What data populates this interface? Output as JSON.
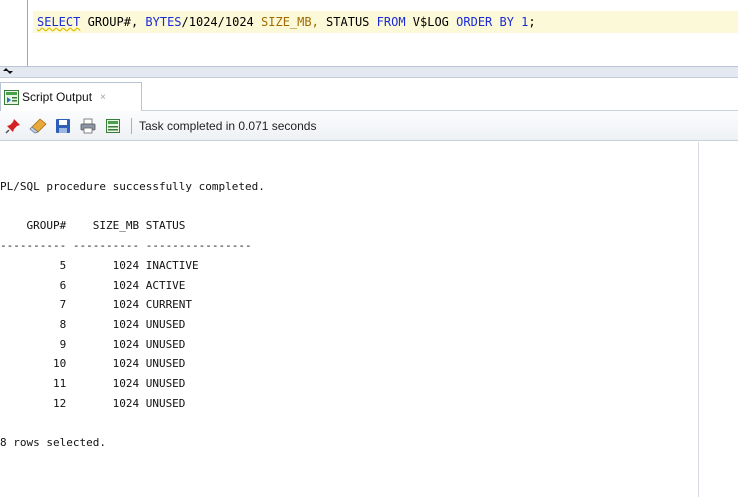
{
  "editor": {
    "query": {
      "select": "SELECT",
      "group_col": "GROUP#,",
      "bytes_kw": "BYTES",
      "expr": "/1024/1024",
      "alias": "SIZE_MB,",
      "status_col": "STATUS",
      "from": "FROM",
      "table": "V$LOG",
      "order_by": "ORDER BY",
      "order_num": "1",
      "terminator": ";"
    }
  },
  "tab": {
    "label": "Script Output",
    "close": "×"
  },
  "toolbar": {
    "status": "Task completed in 0.071 seconds",
    "icons": [
      "pin-icon",
      "eraser-icon",
      "save-icon",
      "print-icon",
      "open-file-icon"
    ]
  },
  "output": {
    "message": "PL/SQL procedure successfully completed.",
    "headers": [
      "GROUP#",
      "SIZE_MB",
      "STATUS"
    ],
    "rows": [
      {
        "group": "5",
        "size_mb": "1024",
        "status": "INACTIVE"
      },
      {
        "group": "6",
        "size_mb": "1024",
        "status": "ACTIVE"
      },
      {
        "group": "7",
        "size_mb": "1024",
        "status": "CURRENT"
      },
      {
        "group": "8",
        "size_mb": "1024",
        "status": "UNUSED"
      },
      {
        "group": "9",
        "size_mb": "1024",
        "status": "UNUSED"
      },
      {
        "group": "10",
        "size_mb": "1024",
        "status": "UNUSED"
      },
      {
        "group": "11",
        "size_mb": "1024",
        "status": "UNUSED"
      },
      {
        "group": "12",
        "size_mb": "1024",
        "status": "UNUSED"
      }
    ],
    "footer": "8 rows selected."
  }
}
